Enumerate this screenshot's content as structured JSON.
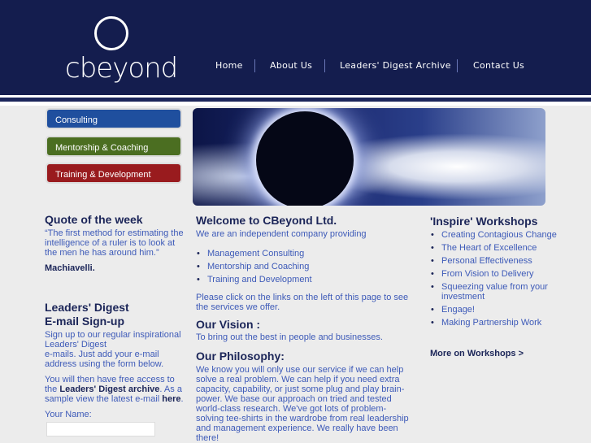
{
  "brand": {
    "logo_text": "cbeyond"
  },
  "nav": [
    "Home",
    "About Us",
    "Leaders' Digest Archive",
    "Contact Us"
  ],
  "sidebar": [
    "Consulting",
    "Mentorship & Coaching",
    "Training & Development"
  ],
  "quote": {
    "title": "Quote of the week",
    "text": "“The first method for estimating the intelligence of a ruler is to look at the men he has around him.”",
    "author": "Machiavelli."
  },
  "signup": {
    "title_line1": "Leaders' Digest",
    "title_line2": "E-mail Sign-up",
    "intro1": "Sign up to our regular inspirational Leaders' Digest",
    "intro2": "e-mails. Just add your e-mail address using the form below.",
    "access_pre": "You will then have free access to the ",
    "access_bold": "Leaders' Digest archive",
    "access_mid": ". As a sample view the latest e-mail ",
    "access_link": "here",
    "access_end": ".",
    "name_label": "Your Name:",
    "name_value": ""
  },
  "welcome": {
    "title": "Welcome to CBeyond Ltd.",
    "intro": "We are an independent company providing",
    "services": [
      "Management Consulting",
      "Mentorship and Coaching",
      "Training and Development"
    ],
    "click_text": "Please click on the links on the left of this page to see the services we offer."
  },
  "vision": {
    "title": "Our Vision :",
    "text": "To bring out the best in people and businesses."
  },
  "philosophy": {
    "title": "Our Philosophy:",
    "text": "We know you will only use our service if we can help solve a real problem. We can help if you need extra capacity, capability, or just some plug and play brain-power. We base our approach on tried and tested world-class research. We've got lots of problem-solving tee-shirts in the wardrobe from real leadership and management experience. We really have been there!"
  },
  "workshops": {
    "title": "'Inspire' Workshops",
    "items": [
      "Creating Contagious Change",
      "The Heart of Excellence",
      "Personal Effectiveness",
      "From Vision to Delivery",
      "Squeezing value from your investment",
      "Engage!",
      "Making Partnership Work"
    ],
    "more": "More on Workshops >"
  },
  "colors": {
    "header": "#141d4e",
    "consulting": "#1f4f9e",
    "mentorship": "#4b6e21",
    "training": "#991b1e",
    "link": "#3d5ab8"
  }
}
